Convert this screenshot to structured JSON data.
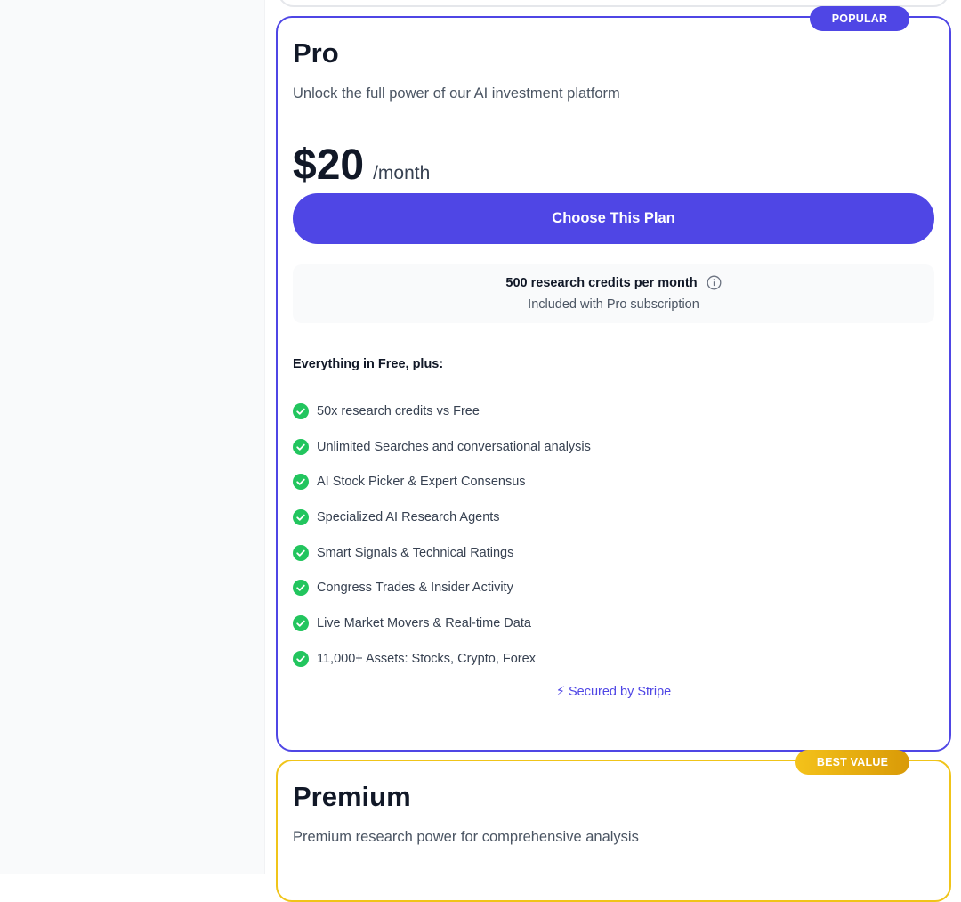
{
  "pro": {
    "badge": "POPULAR",
    "name": "Pro",
    "description": "Unlock the full power of our AI investment platform",
    "price": "$20",
    "period": "/month",
    "cta_label": "Choose This Plan",
    "credits_title": "500 research credits per month",
    "credits_subtitle": "Included with Pro subscription",
    "features_heading": "Everything in Free, plus:",
    "features": [
      "50x research credits vs Free",
      "Unlimited Searches and conversational analysis",
      "AI Stock Picker & Expert Consensus",
      "Specialized AI Research Agents",
      "Smart Signals & Technical Ratings",
      "Congress Trades & Insider Activity",
      "Live Market Movers & Real-time Data",
      "11,000+ Assets: Stocks, Crypto, Forex"
    ],
    "secured_icon": "⚡",
    "secured_text": "Secured by Stripe"
  },
  "premium": {
    "badge": "BEST VALUE",
    "name": "Premium",
    "description": "Premium research power for comprehensive analysis"
  },
  "colors": {
    "accent": "#4f46e5",
    "check": "#22c55e",
    "premium_border": "#f0c419",
    "premium_badge": "#e6ad0f"
  },
  "icons": {
    "info": "info-circle-icon",
    "check": "check-circle-icon",
    "secured": "lightning-icon"
  }
}
